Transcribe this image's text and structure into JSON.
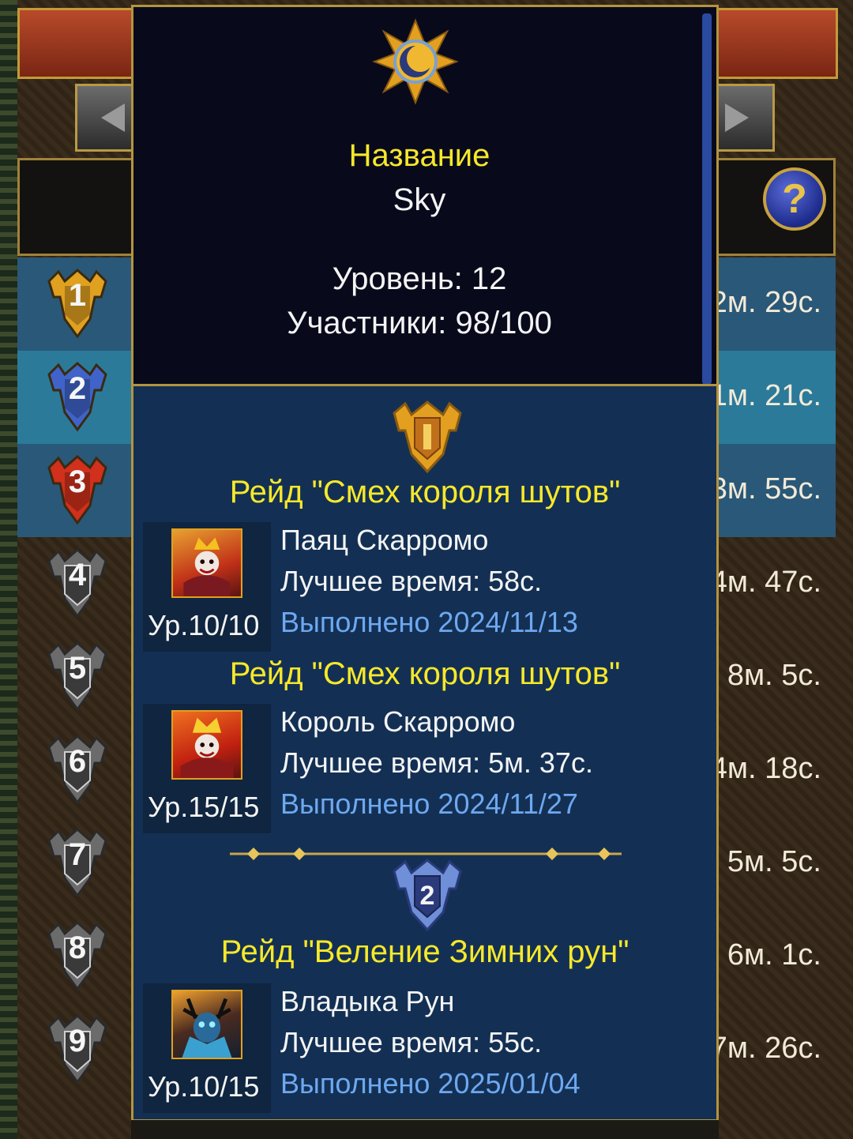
{
  "info": {
    "name_label": "Название",
    "name_value": "Sky",
    "level_text": "Уровень: 12",
    "members_text": "Участники: 98/100"
  },
  "help_icon": "question-icon",
  "ranks": [
    {
      "rank": "1",
      "time": "2м. 29с.",
      "color": "#e0a020"
    },
    {
      "rank": "2",
      "time": "1м. 21с.",
      "color": "#3f63c8"
    },
    {
      "rank": "3",
      "time": "3м. 55с.",
      "color": "#d0301c"
    },
    {
      "rank": "4",
      "time": "4м. 47с.",
      "color": "#6b6b6b"
    },
    {
      "rank": "5",
      "time": "8м. 5с.",
      "color": "#6b6b6b"
    },
    {
      "rank": "6",
      "time": "4м. 18с.",
      "color": "#6b6b6b"
    },
    {
      "rank": "7",
      "time": "5м. 5с.",
      "color": "#6b6b6b"
    },
    {
      "rank": "8",
      "time": "6м. 1с.",
      "color": "#6b6b6b"
    },
    {
      "rank": "9",
      "time": "7м. 26с.",
      "color": "#6b6b6b"
    }
  ],
  "raids": [
    {
      "title": "Рейд \"Смех короля шутов\"",
      "boss": "Паяц Скарромо",
      "best": "Лучшее время: 58с.",
      "level": "Ур.10/10",
      "completed": "Выполнено 2024/11/13"
    },
    {
      "title": "Рейд \"Смех короля шутов\"",
      "boss": "Король Скарромо",
      "best": "Лучшее время: 5м. 37с.",
      "level": "Ур.15/15",
      "completed": "Выполнено 2024/11/27"
    },
    {
      "title": "Рейд \"Веление Зимних рун\"",
      "boss": "Владыка Рун",
      "best": "Лучшее время: 55с.",
      "level": "Ур.10/15",
      "completed": "Выполнено 2025/01/04"
    }
  ],
  "raid_badges": [
    "1",
    "2"
  ]
}
